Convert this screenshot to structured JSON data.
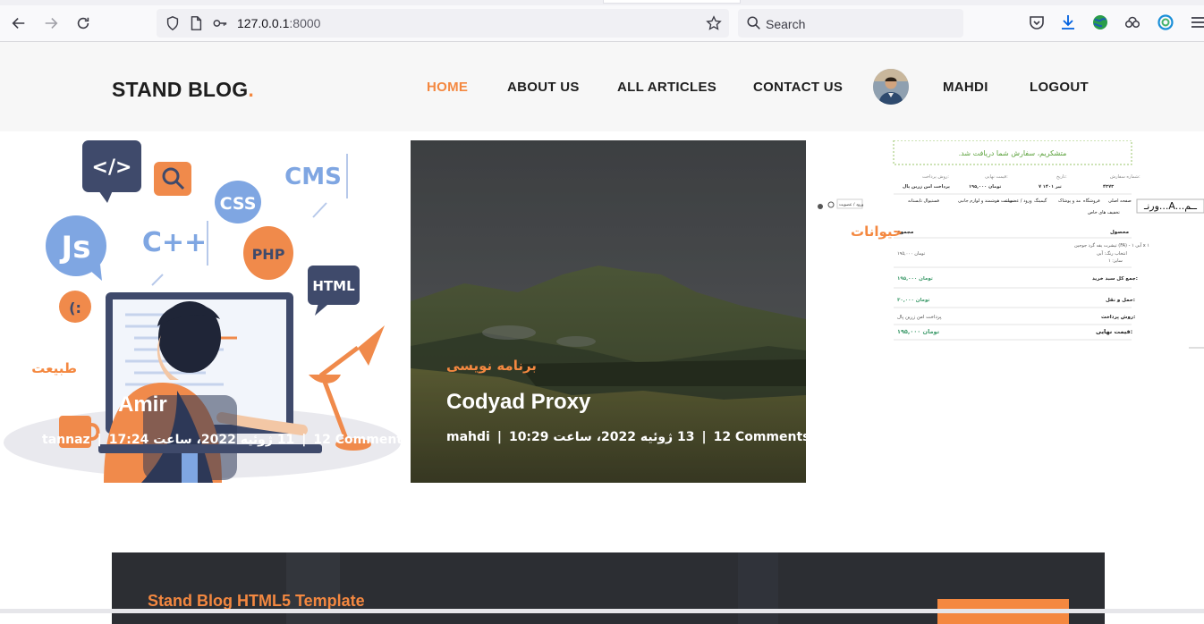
{
  "browser": {
    "url_host": "127.0.0.1",
    "url_port": ":8000",
    "search_placeholder": "Search"
  },
  "site": {
    "logo_text": "STAND BLOG",
    "logo_dot": ".",
    "nav": [
      {
        "label": "HOME",
        "active": true
      },
      {
        "label": "ABOUT US"
      },
      {
        "label": "ALL ARTICLES"
      },
      {
        "label": "CONTACT US"
      },
      {
        "label": "MAHDI"
      },
      {
        "label": "LOGOUT"
      }
    ],
    "accent_color": "#f48840"
  },
  "posts": [
    {
      "category": "طبیعت",
      "title": "Amir",
      "author": "tannaz",
      "date": "11 ژوئیه 2022، ساعت 17:24",
      "comments": "12 Comments"
    },
    {
      "category": "برنامه نویسی",
      "title": "Codyad Proxy",
      "author": "mahdi",
      "date": "13 ژوئیه 2022، ساعت 10:29",
      "comments": "12 Comments"
    },
    {
      "category": "حیوانات",
      "receipt_banner": "متشکریم، سفارش شما دریافت شد.",
      "side_label": "ورنـ...A...ــم",
      "receipt_rows": [
        {
          "label": "محصول",
          "value": "مجموع"
        },
        {
          "label": "جمع کل سبد خرید:",
          "value": "۱۹۵,۰۰۰ تومان"
        },
        {
          "label": "حمل و نقل:",
          "value": "۳۰,۰۰۰ تومان"
        },
        {
          "label": "روش پرداخت:",
          "value": "پرداخت امن زرین پال"
        },
        {
          "label": "قیمت نهایی:",
          "value": "۱۹۵,۰۰۰ تومان"
        }
      ]
    }
  ],
  "cta": {
    "title": "Stand Blog HTML5 Template"
  }
}
